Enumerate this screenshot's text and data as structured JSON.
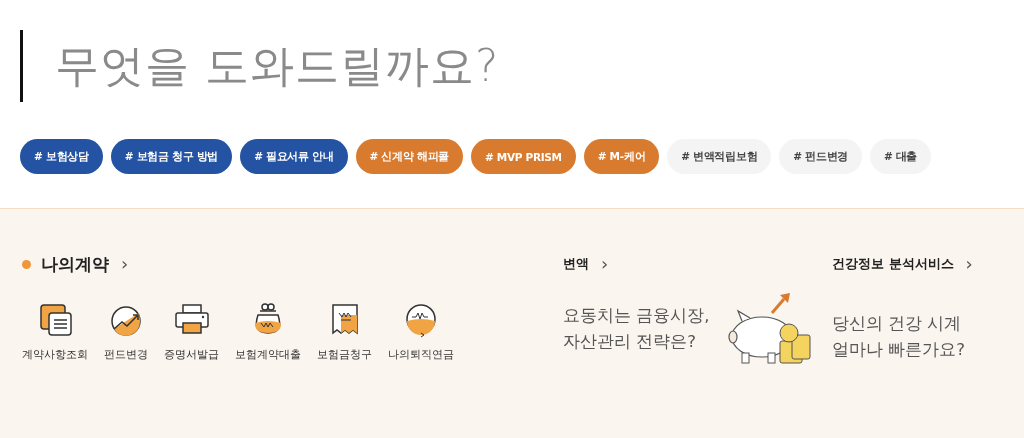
{
  "heading": "무엇을 도와드릴까요?",
  "tags": [
    {
      "label": "# 보험상담",
      "color": "#2453a3"
    },
    {
      "label": "# 보험금 청구 방법",
      "color": "#2453a3"
    },
    {
      "label": "# 필요서류 안내",
      "color": "#2453a3"
    },
    {
      "label": "# 신계약 해피콜",
      "color": "#d97b2f"
    },
    {
      "label": "# MVP PRISM",
      "color": "#d97b2f"
    },
    {
      "label": "# M-케어",
      "color": "#d97b2f"
    },
    {
      "label": "# 변액적립보험",
      "color": "#f4f4f4"
    },
    {
      "label": "# 펀드변경",
      "color": "#f4f4f4"
    },
    {
      "label": "# 대출",
      "color": "#f4f4f4"
    }
  ],
  "my_contract": {
    "title": "나의계약",
    "arrow": "›",
    "items": [
      {
        "label": "계약사항조회",
        "kind": "documents"
      },
      {
        "label": "펀드변경",
        "kind": "chart"
      },
      {
        "label": "증명서발급",
        "kind": "printer"
      },
      {
        "label": "보험계약대출",
        "kind": "pouch"
      },
      {
        "label": "보험금청구",
        "kind": "receipt"
      },
      {
        "label": "나의퇴직연금",
        "kind": "clock"
      }
    ]
  },
  "variable": {
    "title": "변액",
    "arrow": "›",
    "lines": [
      "요동치는 금융시장,",
      "자산관리 전략은?"
    ]
  },
  "health": {
    "title": "건강정보 분석서비스",
    "arrow": "›",
    "lines": [
      "당신의 건강 시계",
      "얼마나 빠른가요?"
    ]
  }
}
